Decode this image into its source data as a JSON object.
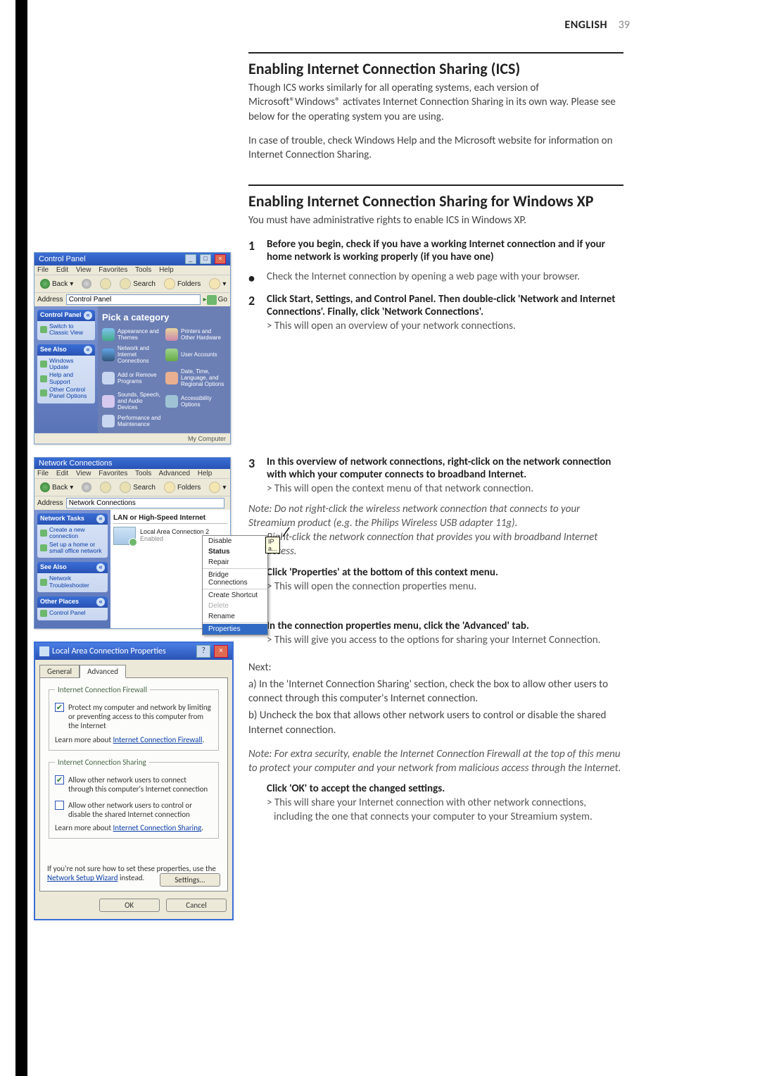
{
  "header": {
    "lang": "ENGLISH",
    "page": "39"
  },
  "section1": {
    "title": "Enabling Internet Connection Sharing (ICS)",
    "p1": "Though ICS works similarly for all operating systems, each version of Microsoft®Windows® activates Internet Connection Sharing in its own way. Please see below for the operating system you are using.",
    "p2": "In case of trouble, check Windows Help and the Microsoft website for information on Internet Connection Sharing."
  },
  "section2": {
    "title": "Enabling Internet Connection Sharing for Windows XP",
    "intro": "You must have administrative rights to enable ICS in Windows XP.",
    "steps": {
      "s1_bold": "Before you begin, check if you have a working Internet connection and if your home network is working properly (if you have one)",
      "s1_bullet": "Check the Internet connection by opening a web page with your browser.",
      "s2_bold": "Click Start, Settings, and Control Panel. Then double-click 'Network and Internet Connections'. Finally, click 'Network Connections'.",
      "s2_sub": "> This will open an overview of your network connections.",
      "s3_bold": "In this overview of network connections, right-click on the network connection with which your computer connects to broadband Internet.",
      "s3_sub": "> This will open the context menu of that network connection.",
      "note1a": "Note: Do not right-click the wireless network connection that connects to your Streamium product (e.g. the Philips Wireless USB adapter 11g).",
      "note1b": "Right-click the network connection that provides you with broadband Internet access.",
      "s4_bold": "Click 'Properties' at the bottom of this context menu.",
      "s4_sub": "> This will open the connection properties menu.",
      "s5_bold": "In the connection properties menu, click the 'Advanced' tab.",
      "s5_sub": "> This will give you access to the options for sharing your Internet Connection."
    },
    "next": {
      "label": "Next:",
      "a": "a) In the 'Internet Connection Sharing' section, check the box to allow other users to connect through this computer's Internet connection.",
      "b": "b) Uncheck the box that allows other network users to control or disable the shared Internet connection."
    },
    "note2": "Note: For extra security, enable the Internet Connection Firewall at the top of this menu to protect your computer and your network from malicious access through the Internet.",
    "ok_bold": "Click 'OK' to accept the changed settings.",
    "ok_sub1": "> This will share your Internet connection with other network connections,",
    "ok_sub2": "including the one that connects your computer to your Streamium system."
  },
  "fig1": {
    "title": "Control Panel",
    "menu": [
      "File",
      "Edit",
      "View",
      "Favorites",
      "Tools",
      "Help"
    ],
    "toolbar": {
      "back": "Back",
      "search": "Search",
      "folders": "Folders"
    },
    "address_label": "Address",
    "address_value": "Control Panel",
    "go": "Go",
    "side_cp_hdr": "Control Panel",
    "side_cp_link": "Switch to Classic View",
    "side_sa_hdr": "See Also",
    "side_sa_links": [
      "Windows Update",
      "Help and Support",
      "Other Control Panel Options"
    ],
    "pick": "Pick a category",
    "cats": [
      "Appearance and Themes",
      "Printers and Other Hardware",
      "Network and Internet Connections",
      "User Accounts",
      "Add or Remove Programs",
      "Date, Time, Language, and Regional Options",
      "Sounds, Speech, and Audio Devices",
      "Accessibility Options",
      "Performance and Maintenance"
    ],
    "status": "My Computer"
  },
  "fig2": {
    "title": "Network Connections",
    "menu": [
      "File",
      "Edit",
      "View",
      "Favorites",
      "Tools",
      "Advanced",
      "Help"
    ],
    "toolbar": {
      "back": "Back",
      "search": "Search",
      "folders": "Folders"
    },
    "address_label": "Address",
    "address_value": "Network Connections",
    "side_nt_hdr": "Network Tasks",
    "side_nt_links": [
      "Create a new connection",
      "Set up a home or small office network"
    ],
    "side_sa_hdr": "See Also",
    "side_sa_links": [
      "Network Troubleshooter"
    ],
    "side_op_hdr": "Other Places",
    "side_op_links": [
      "Control Panel"
    ],
    "group": "LAN or High-Speed Internet",
    "conn_name": "Local Area Connection 2",
    "conn_state": "Enabled",
    "tooltip": "IP a...",
    "ctx": [
      "Disable",
      "Status",
      "Repair",
      "Bridge Connections",
      "Create Shortcut",
      "Delete",
      "Rename",
      "Properties"
    ]
  },
  "fig3": {
    "title": "Local Area Connection Properties",
    "tabs": {
      "general": "General",
      "advanced": "Advanced"
    },
    "fs1": {
      "legend": "Internet Connection Firewall",
      "chk": "Protect my computer and network by limiting or preventing access to this computer from the Internet",
      "learn_pre": "Learn more about ",
      "learn_link": "Internet Connection Firewall"
    },
    "fs2": {
      "legend": "Internet Connection Sharing",
      "chk1": "Allow other network users to connect through this computer's Internet connection",
      "chk2": "Allow other network users to control or disable the shared Internet connection",
      "learn_pre": "Learn more about ",
      "learn_link": "Internet Connection Sharing"
    },
    "hint_pre": "If you're not sure how to set these properties, use the ",
    "hint_link": "Network Setup Wizard",
    "hint_post": " instead.",
    "btn_settings": "Settings...",
    "btn_ok": "OK",
    "btn_cancel": "Cancel"
  }
}
